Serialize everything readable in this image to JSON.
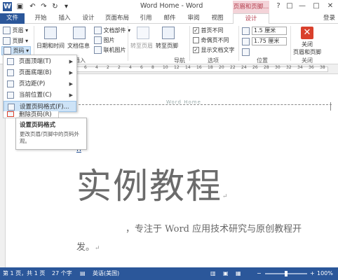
{
  "window": {
    "title": "Word Home - Word",
    "context_tab_group": "页眉和页脚...",
    "help_btn": "?",
    "restore_btn": "□",
    "minimize_btn": "—",
    "maximize_btn": "□",
    "close_btn": "✕"
  },
  "qat": {
    "icons": [
      "word-logo-icon",
      "save-icon",
      "undo-icon",
      "redo-icon",
      "repeat-icon",
      "customize-qat-icon"
    ]
  },
  "tabs": {
    "file": "文件",
    "home": "开始",
    "insert": "插入",
    "design_main": "设计",
    "page_layout": "页面布局",
    "references": "引用",
    "mailings": "邮件",
    "review": "审阅",
    "view": "视图",
    "design": "设计",
    "login": "登录"
  },
  "ribbon": {
    "header": "页眉",
    "footer": "页脚",
    "page_number": "页码",
    "date_time": "日期和时间",
    "doc_info": "文档信息",
    "doc_parts": "文档部件",
    "picture": "图片",
    "online_picture": "联机图片",
    "goto_header": "转至页眉",
    "goto_footer": "转至页脚",
    "group_insert": "插入",
    "group_nav": "导航",
    "opt_first_page": "首页不同",
    "opt_odd_even": "奇偶页不同",
    "opt_show_text": "显示文档文字",
    "group_options": "选项",
    "pos_top": "1.5 厘米",
    "pos_bottom": "1.75 厘米",
    "group_position": "位置",
    "close_label_1": "关闭",
    "close_label_2": "页眉和页脚",
    "group_close": "关闭",
    "close_icon_glyph": "✕",
    "dropdown_glyph": "▾",
    "checked_glyph": "✓"
  },
  "ruler": {
    "numbers": [
      "8",
      "6",
      "4",
      "2",
      "2",
      "4",
      "6",
      "8",
      "10",
      "12",
      "14",
      "16",
      "18",
      "20",
      "22",
      "24",
      "26",
      "28",
      "30",
      "32",
      "34",
      "36",
      "38"
    ]
  },
  "menu": {
    "items": [
      {
        "label": "页面顶端(T)",
        "arrow": "▶"
      },
      {
        "label": "页面底端(B)",
        "arrow": "▶"
      },
      {
        "label": "页边距(P)",
        "arrow": "▶"
      },
      {
        "label": "当前位置(C)",
        "arrow": "▶"
      },
      {
        "label": "设置页码格式(F)..."
      },
      {
        "label": "删除页码(R)"
      }
    ]
  },
  "tooltip": {
    "title": "设置页码格式",
    "desc": "更改页眉/页脚中的页码外观。"
  },
  "document": {
    "header_text": "Word Home",
    "h_letter": "h",
    "title": "实例教程",
    "title_mark": "↵",
    "para_line1": "，专注于 Word 应用技术研究与原创教程开",
    "para_line2": "发。",
    "para_mark": "↵"
  },
  "status": {
    "page": "第 1 页，共 1 页",
    "words": "27 个字",
    "language": "英语(美国)",
    "zoom_minus": "−",
    "zoom_plus": "+",
    "zoom": "100%",
    "zoom_fraction": 0.5
  },
  "colors": {
    "accent": "#2b579a",
    "context_tab": "#b33a4a"
  }
}
